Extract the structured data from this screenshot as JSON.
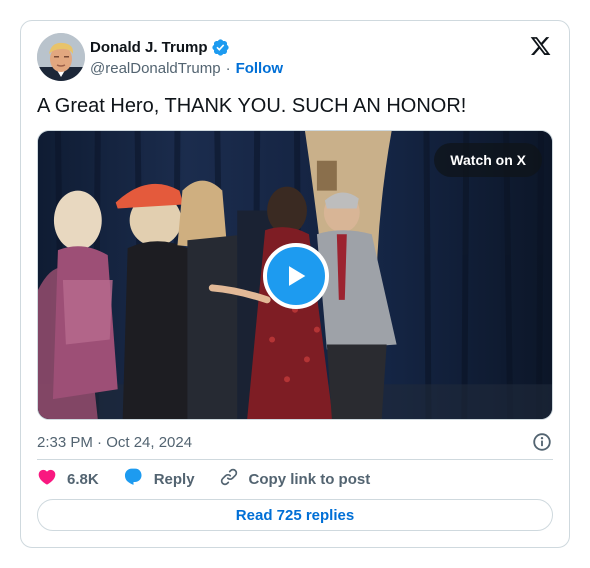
{
  "author": {
    "display_name": "Donald J. Trump",
    "handle": "@realDonaldTrump",
    "separator": "·",
    "follow_label": "Follow"
  },
  "tweet": {
    "text": "A Great Hero, THANK YOU. SUCH AN HONOR!",
    "timestamp": "2:33 PM · Oct 24, 2024"
  },
  "media": {
    "watch_label": "Watch on X"
  },
  "actions": {
    "like_count": "6.8K",
    "reply_label": "Reply",
    "copy_link_label": "Copy link to post"
  },
  "read_replies_label": "Read 725 replies",
  "colors": {
    "link_blue": "#006fd6",
    "play_blue": "#1d9bf0",
    "like_pink": "#f91880",
    "muted_text": "#536471",
    "border": "#cfd9de"
  }
}
